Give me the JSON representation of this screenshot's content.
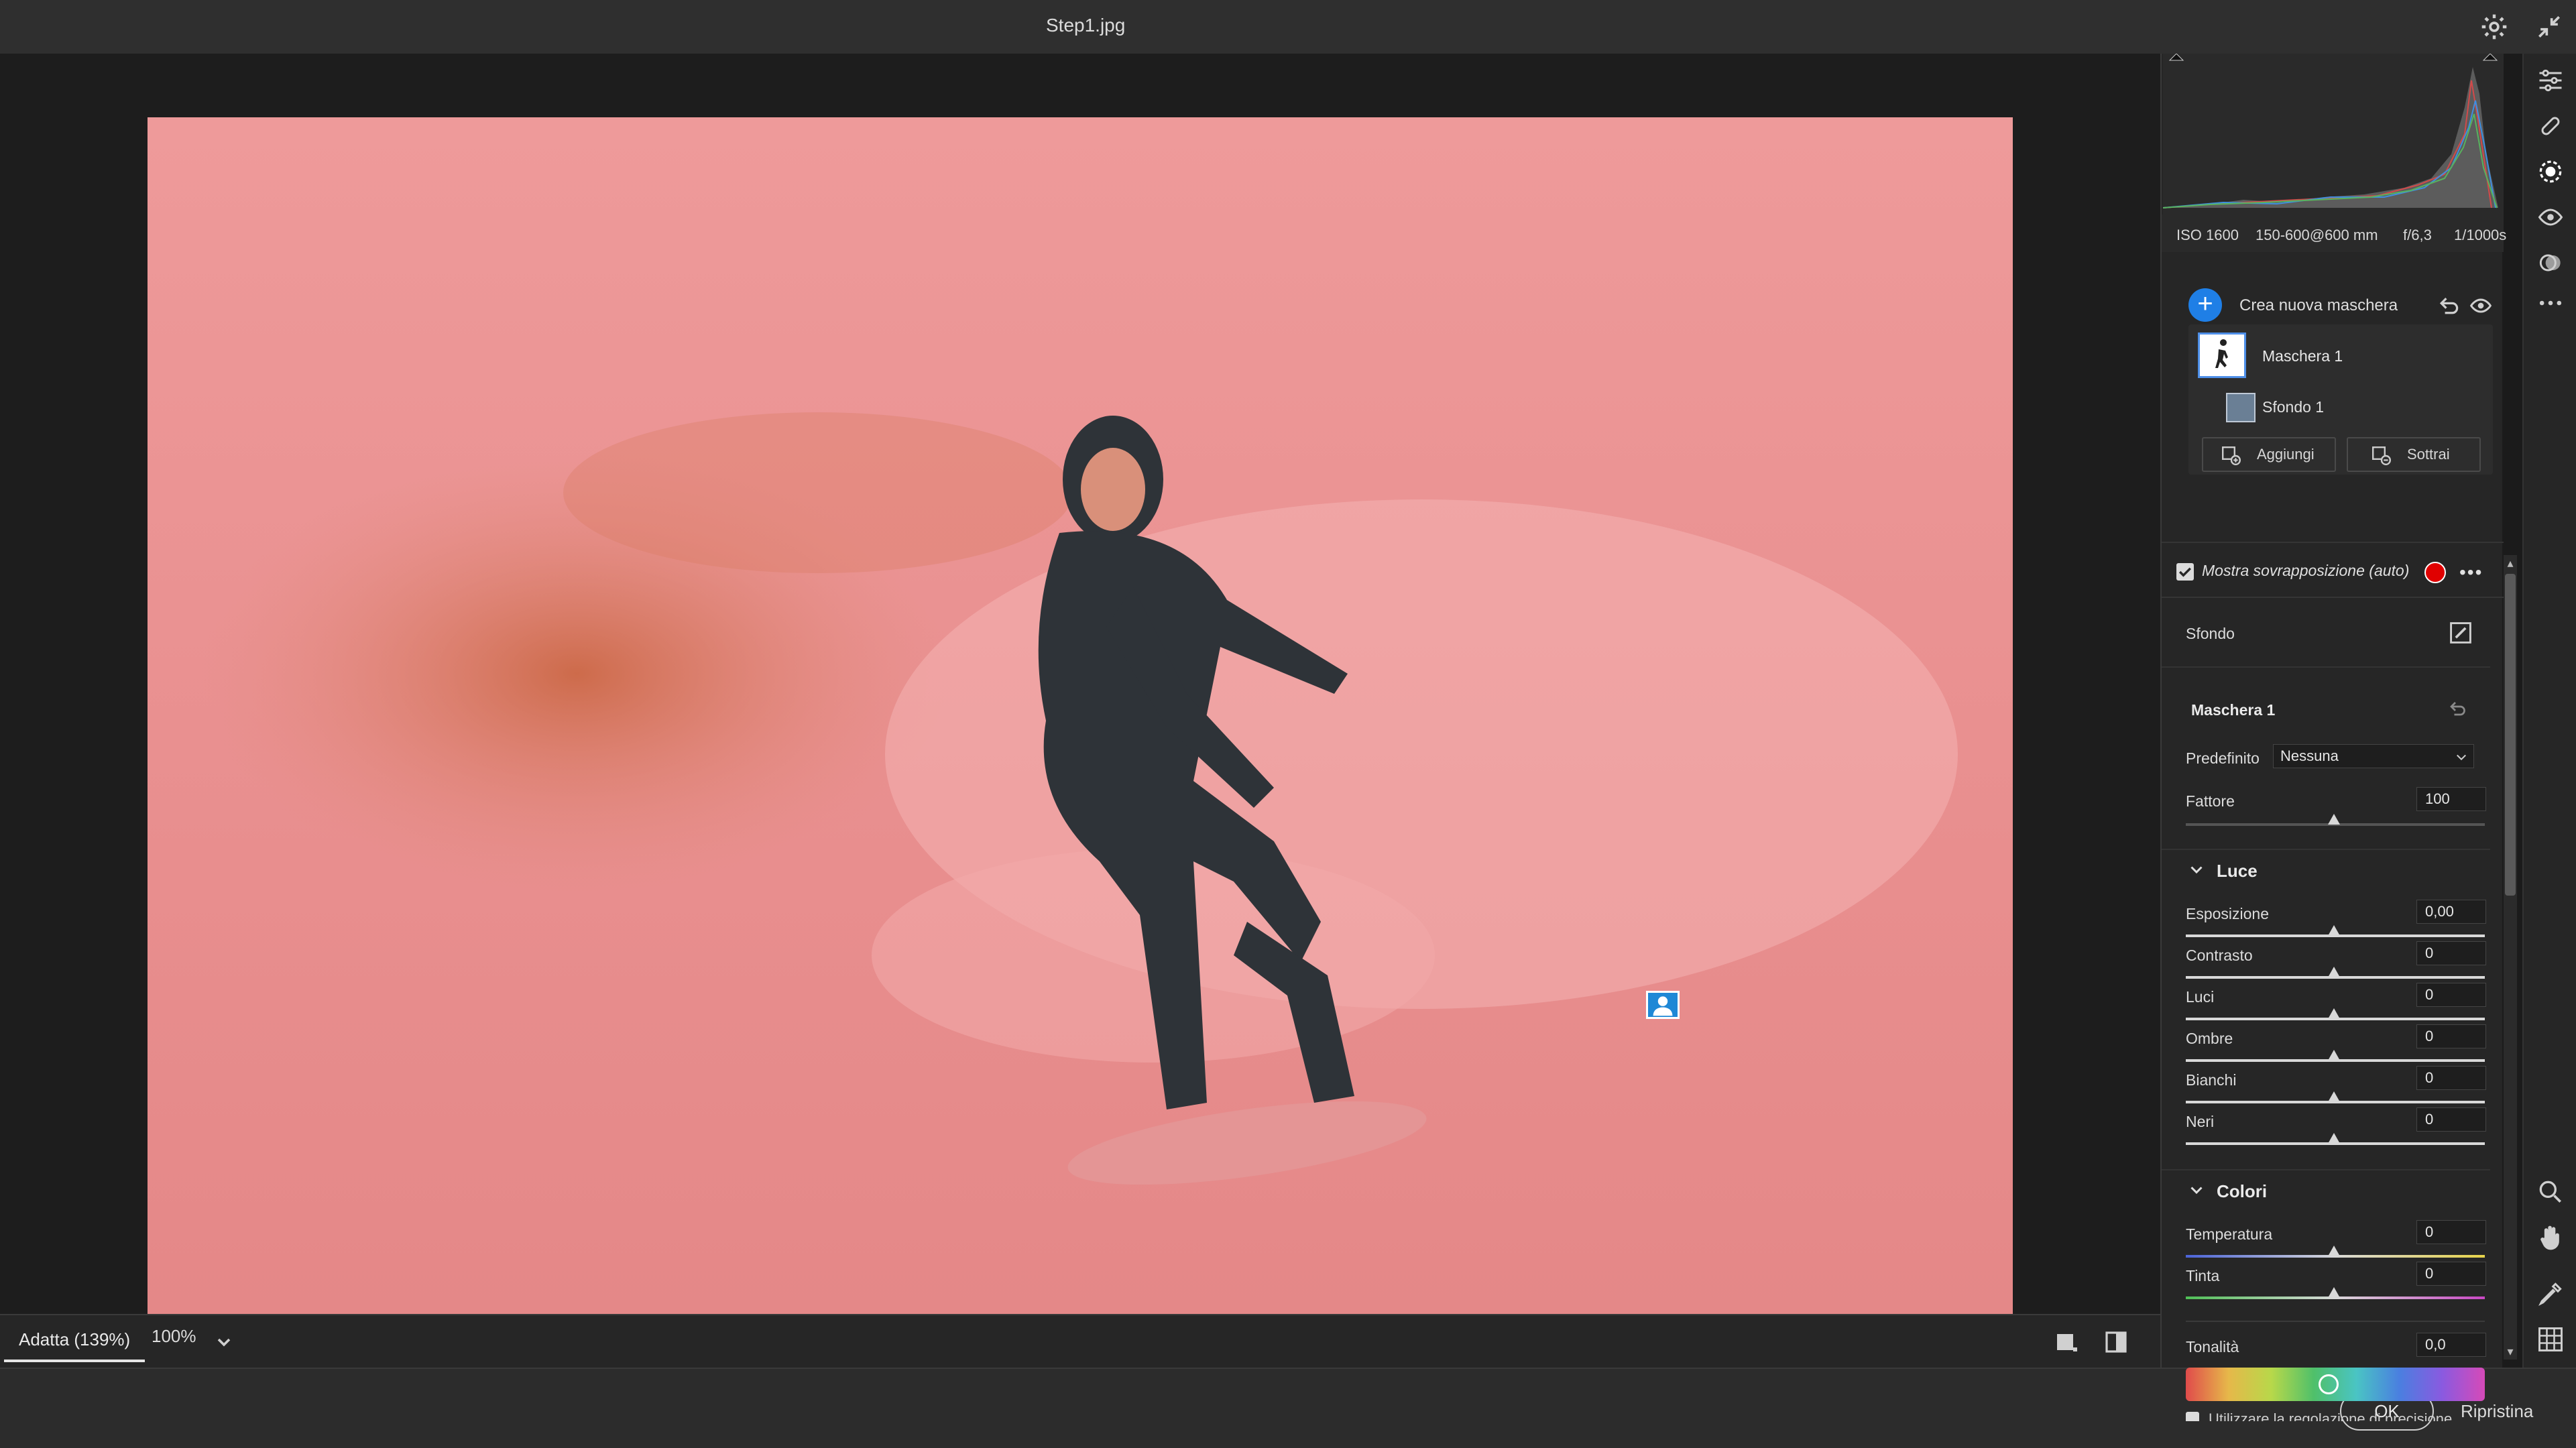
{
  "window": {
    "title": "Step1.jpg"
  },
  "exif": {
    "iso": "ISO 1600",
    "lens": "150-600@600 mm",
    "aperture": "f/6,3",
    "shutter": "1/1000s"
  },
  "masks": {
    "create_label": "Crea nuova maschera",
    "items": [
      {
        "label": "Maschera 1"
      },
      {
        "label": "Sfondo 1"
      }
    ],
    "add_label": "Aggiungi",
    "subtract_label": "Sottrai"
  },
  "overlay": {
    "label": "Mostra sovrapposizione (auto)",
    "color": "#e00000",
    "checked": true,
    "more": "•••"
  },
  "background_section": {
    "label": "Sfondo"
  },
  "mask_settings": {
    "title": "Maschera 1",
    "preset_label": "Predefinito",
    "preset_value": "Nessuna",
    "factor_label": "Fattore",
    "factor_value": "100"
  },
  "light": {
    "title": "Luce",
    "sliders": [
      {
        "label": "Esposizione",
        "value": "0,00"
      },
      {
        "label": "Contrasto",
        "value": "0"
      },
      {
        "label": "Luci",
        "value": "0"
      },
      {
        "label": "Ombre",
        "value": "0"
      },
      {
        "label": "Bianchi",
        "value": "0"
      },
      {
        "label": "Neri",
        "value": "0"
      }
    ]
  },
  "colors": {
    "title": "Colori",
    "sliders": [
      {
        "label": "Temperatura",
        "value": "0"
      },
      {
        "label": "Tinta",
        "value": "0"
      }
    ],
    "hue_label": "Tonalità",
    "hue_value": "0,0",
    "refine_label": "Utilizzare la regolazione di precisione"
  },
  "zoom": {
    "fit_label": "Adatta (139%)",
    "zoom_label": "100%"
  },
  "footer": {
    "ok_label": "OK",
    "reset_label": "Ripristina"
  },
  "accent_color": "#1f7fe6"
}
